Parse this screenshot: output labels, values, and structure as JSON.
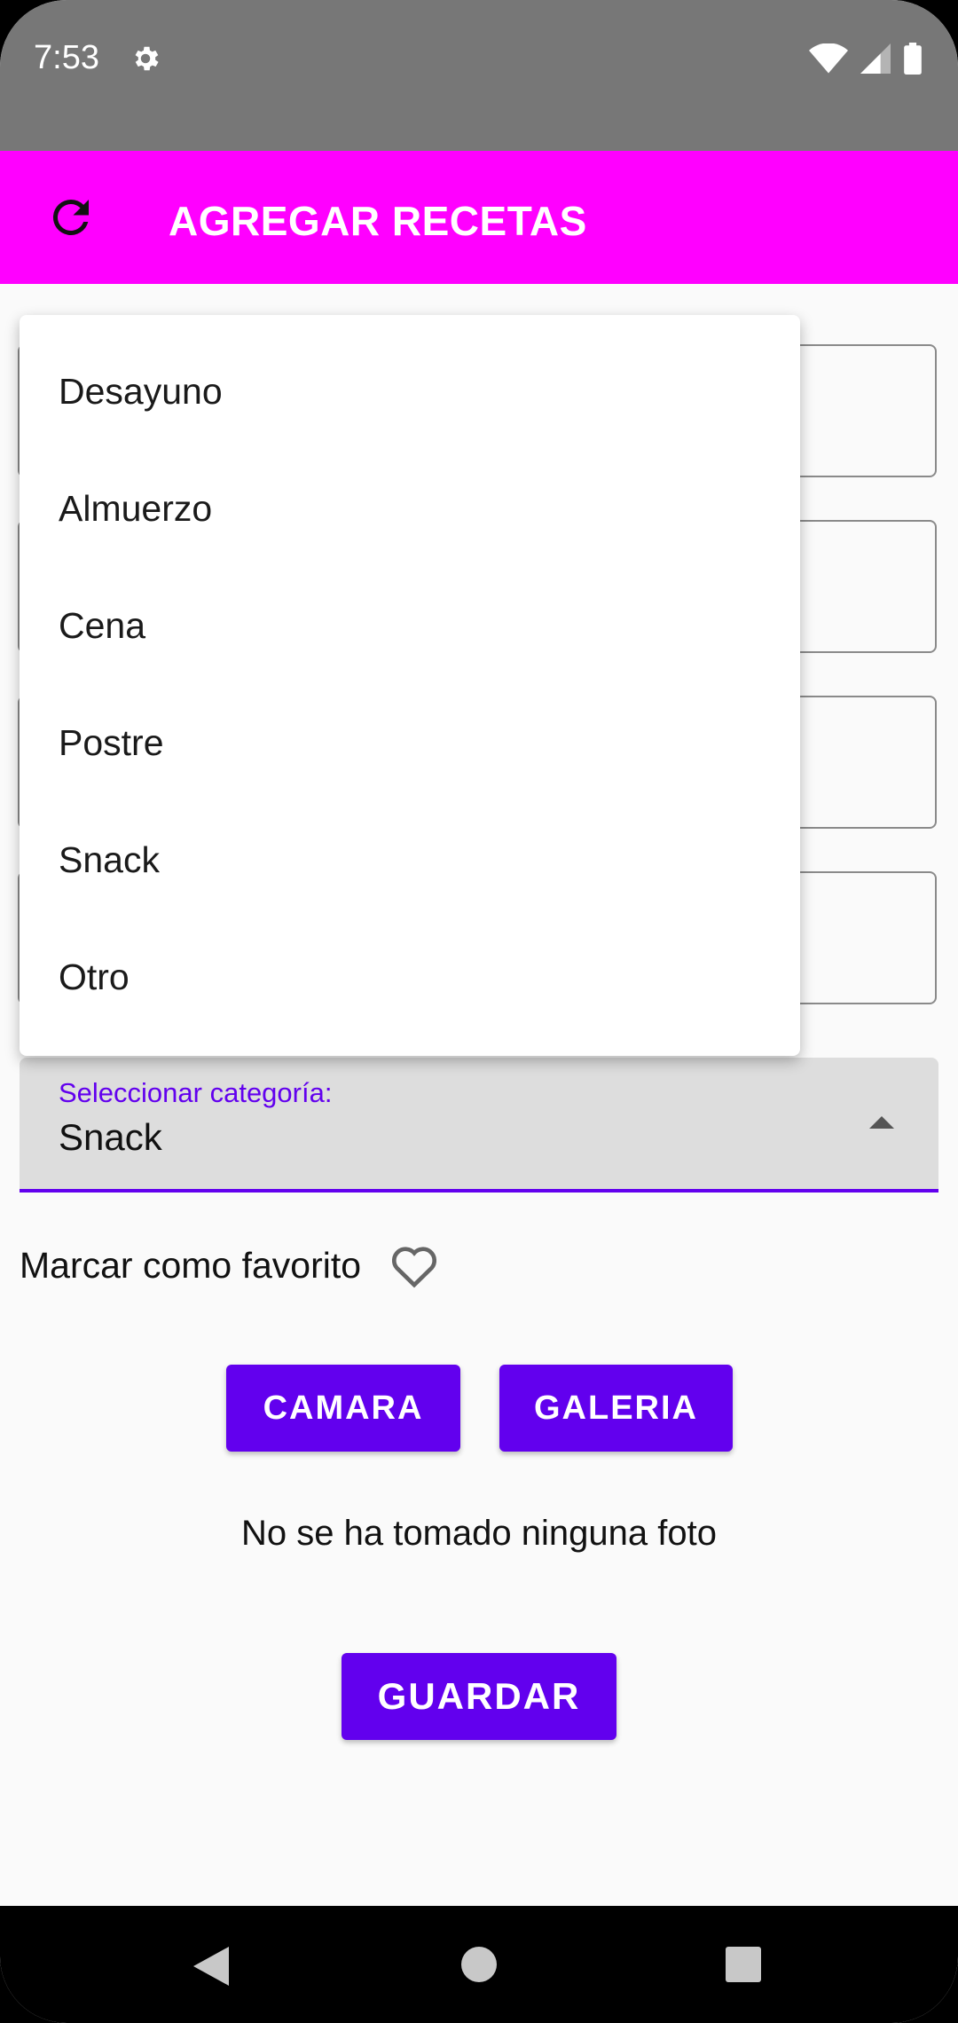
{
  "status_bar": {
    "time": "7:53"
  },
  "app_bar": {
    "title": "AGREGAR RECETAS"
  },
  "dropdown": {
    "label": "Seleccionar categoría:",
    "selected": "Snack",
    "options": [
      "Desayuno",
      "Almuerzo",
      "Cena",
      "Postre",
      "Snack",
      "Otro"
    ]
  },
  "favorite": {
    "label": "Marcar como favorito"
  },
  "buttons": {
    "camera": "CAMARA",
    "gallery": "GALERIA",
    "save": "GUARDAR"
  },
  "photo_status": "No se ha tomado ninguna foto",
  "colors": {
    "app_bar": "#ff00ff",
    "accent": "#6200ee",
    "status_bar": "#777777"
  }
}
